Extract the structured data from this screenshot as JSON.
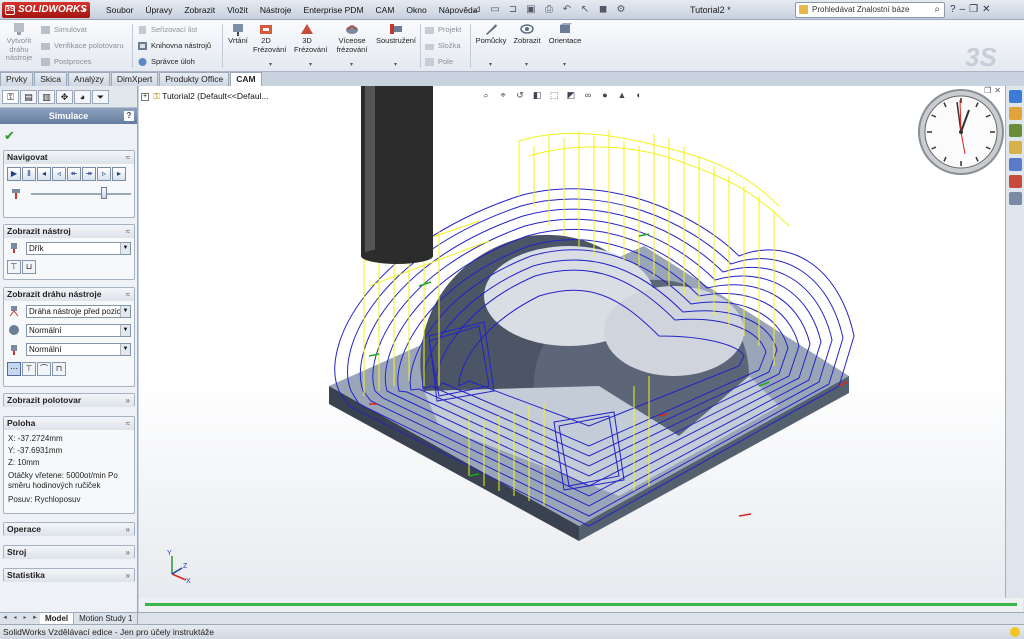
{
  "app": {
    "brand": "SOLIDWORKS",
    "document_title": "Tutorial2 *",
    "menus": [
      "Soubor",
      "Úpravy",
      "Zobrazit",
      "Vložit",
      "Nástroje",
      "Enterprise PDM",
      "CAM",
      "Okno",
      "Nápověda"
    ],
    "search_placeholder": "Prohledávat Znalostní báze"
  },
  "commandmanager": {
    "generate_toolpath": "Vytvořit dráhu nástroje",
    "simulate": "Simulovat",
    "verify_stock": "Verifikace polotovaru",
    "postprocess": "Postproces",
    "setup_sheet": "Seřizovací list",
    "tool_library": "Knihovna nástrojů",
    "job_manager": "Správce úloh",
    "drilling": "Vrtání",
    "milling_2d": "2D Frézování",
    "milling_3d": "3D Frézování",
    "multiaxis": "Víceose frézování",
    "turning": "Soustružení",
    "project": "Projekt",
    "folder": "Složka",
    "field": "Pole",
    "tools": "Pomůcky",
    "show": "Zobrazit",
    "orientation": "Orientace"
  },
  "tabs": [
    "Prvky",
    "Skica",
    "Analýzy",
    "DimXpert",
    "Produkty Office",
    "CAM"
  ],
  "active_tab": "CAM",
  "panel": {
    "title": "Simulace",
    "navigate": "Navigovat",
    "show_tool": "Zobrazit nástroj",
    "tool_shape": "Dřík",
    "show_toolpath": "Zobrazit dráhu nástroje",
    "toolpath_mode": "Dráha nástroje před pozicí",
    "display_1": "Normální",
    "display_2": "Normální",
    "show_stock": "Zobrazit polotovar",
    "position": "Poloha",
    "x": "X: -37.2724mm",
    "y": "Y: -37.6931mm",
    "z": "Z: 10mm",
    "spindle_1": "Otáčky vřetene: 5000ot/min Po",
    "spindle_2": "směru hodinových ručiček",
    "feed": "Posuv: Rychloposuv",
    "operation": "Operace",
    "machine": "Stroj",
    "statistics": "Statistika"
  },
  "viewport": {
    "tree_label": "Tutorial2  (Default<<Defaul..."
  },
  "bottom_tabs": [
    "Model",
    "Motion Study 1"
  ],
  "status": "SolidWorks Vzdělávací edice - Jen pro účely instruktáže",
  "colors": {
    "toolpath_yellow": "#f2f21a",
    "toolpath_blue": "#2323c8",
    "timeline_green": "#39b54a"
  }
}
